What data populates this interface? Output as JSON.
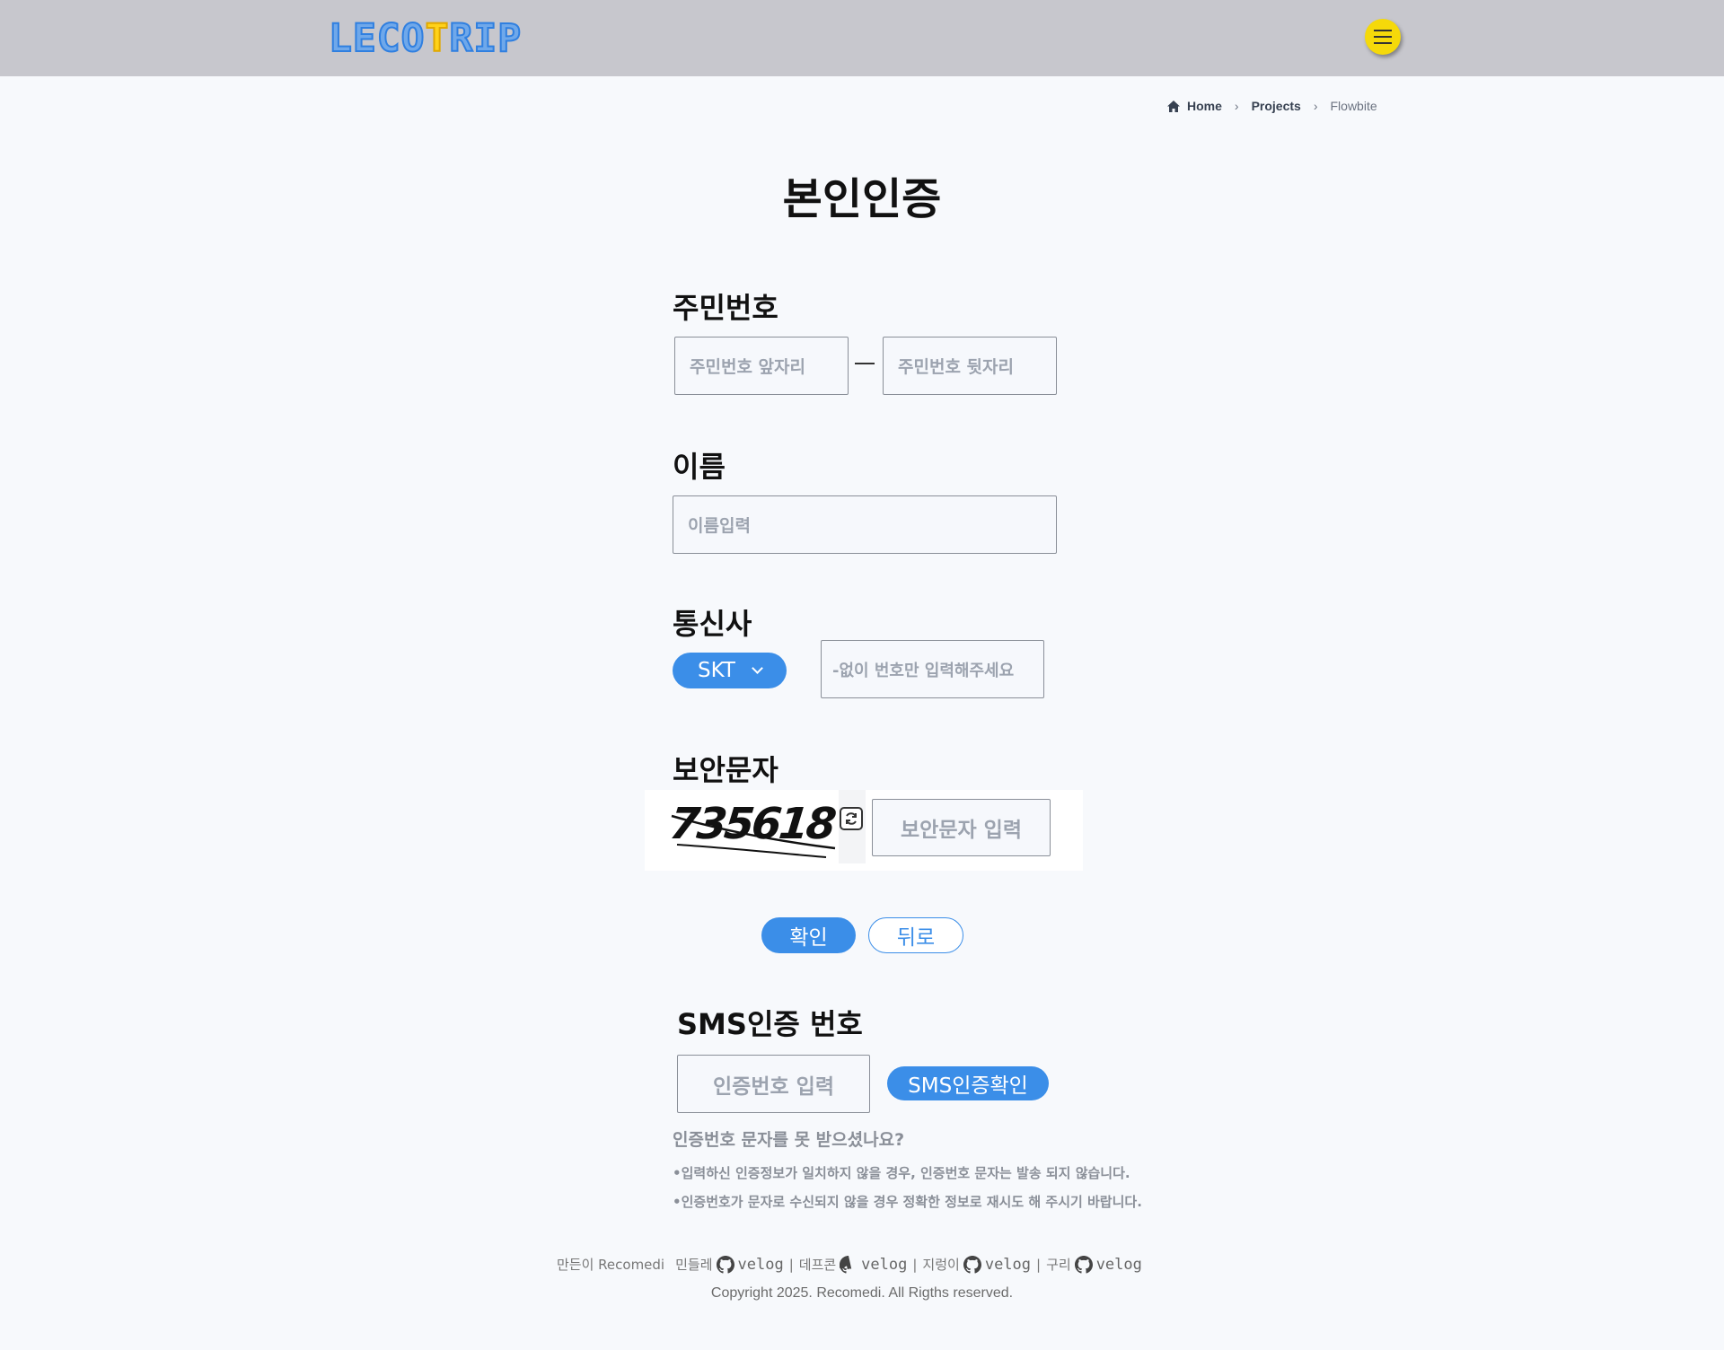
{
  "header": {
    "logo_part1": "LECO",
    "logo_part2": "T",
    "logo_part3": "RIP"
  },
  "breadcrumb": {
    "home": "Home",
    "projects": "Projects",
    "current": "Flowbite"
  },
  "page_title": "본인인증",
  "rrn": {
    "label": "주민번호",
    "front_placeholder": "주민번호 앞자리",
    "back_placeholder": "주민번호 뒷자리"
  },
  "name": {
    "label": "이름",
    "placeholder": "이름입력"
  },
  "carrier": {
    "label": "통신사",
    "selected": "SKT",
    "phone_placeholder": "-없이 번호만 입력해주세요"
  },
  "captcha": {
    "label": "보안문자",
    "code": "735618",
    "input_placeholder": "보안문자 입력"
  },
  "actions": {
    "confirm": "확인",
    "back": "뒤로"
  },
  "sms": {
    "label": "SMS인증 번호",
    "input_placeholder": "인증번호 입력",
    "confirm_button": "SMS인증확인",
    "notice_title": "인증번호 문자를 못 받으셨나요?",
    "notice_1": "•입력하신 인증정보가 일치하지 않을 경우, 인증번호 문자는 발송 되지 않습니다.",
    "notice_2": "•인증번호가 문자로 수신되지 않을 경우 정확한 정보로 재시도 해 주시기 바랍니다."
  },
  "footer": {
    "made_by": "만든이 Recomedi",
    "members": [
      {
        "name": "민들레",
        "link": "velog"
      },
      {
        "name": "데프콘",
        "link": "velog"
      },
      {
        "name": "지렁이",
        "link": "velog"
      },
      {
        "name": "구리",
        "link": "velog"
      }
    ],
    "separator": "|",
    "copyright": "Copyright 2025. Recomedi. All Rigths reserved."
  },
  "colors": {
    "accent": "#3b8ee8",
    "header_bg": "#c7c7cd",
    "menu_button": "#f5d90a",
    "placeholder": "#9ca3af"
  },
  "icons": [
    "home-icon",
    "chevron-right-icon",
    "hamburger-menu-icon",
    "chevron-down-icon",
    "refresh-icon",
    "github-icon"
  ]
}
